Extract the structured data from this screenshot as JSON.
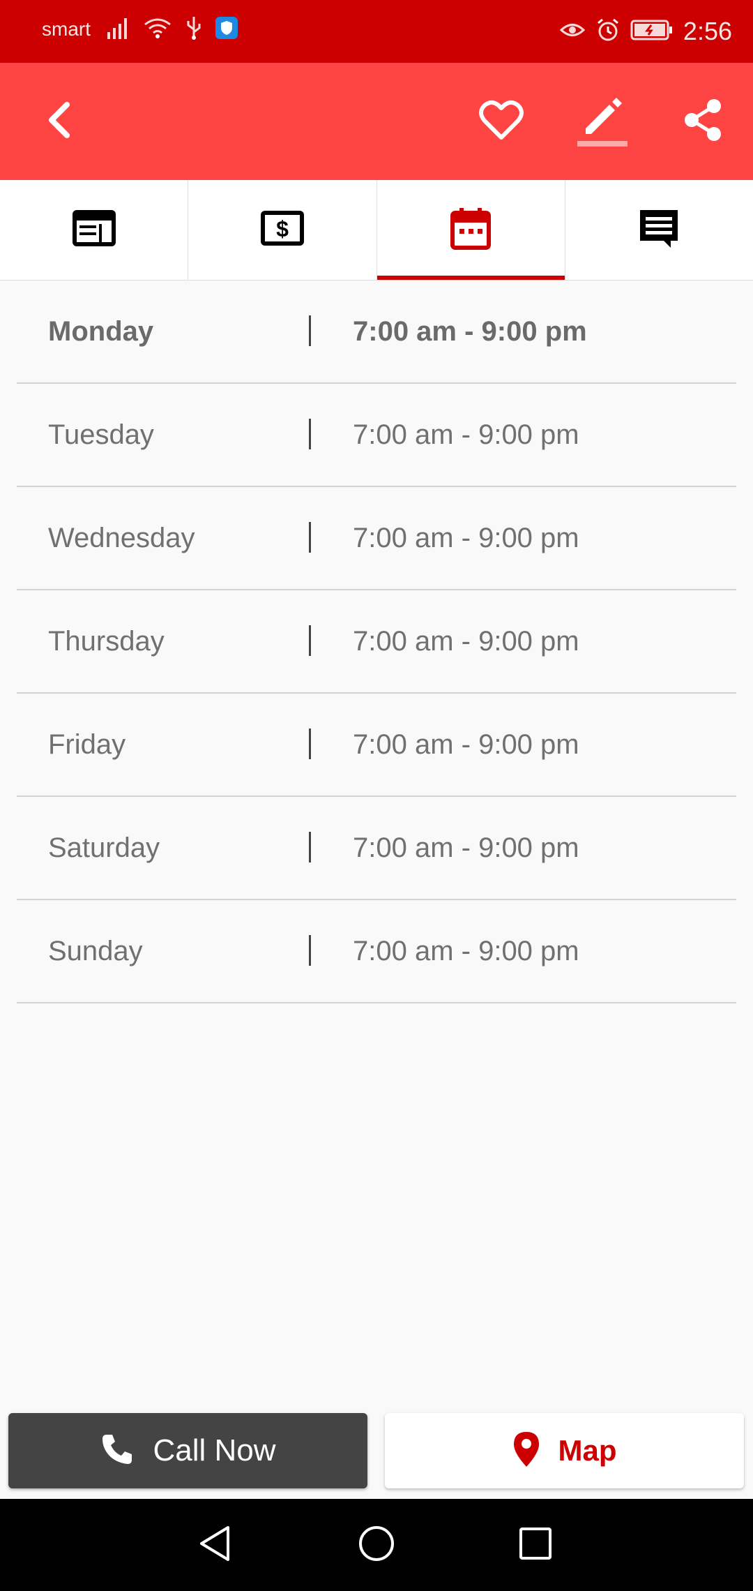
{
  "status_bar": {
    "carrier": "smart",
    "time": "2:56",
    "icons_left": [
      "signal-icon",
      "wifi-icon",
      "usb-icon",
      "shield-app-icon"
    ],
    "icons_right": [
      "eye-comfort-icon",
      "alarm-icon",
      "battery-icon"
    ]
  },
  "app_bar": {
    "actions": [
      "back-icon",
      "heart-icon",
      "edit-icon",
      "share-icon"
    ]
  },
  "tabs": {
    "items": [
      {
        "name": "overview-icon",
        "active": false
      },
      {
        "name": "price-icon",
        "active": false
      },
      {
        "name": "calendar-icon",
        "active": true
      },
      {
        "name": "comments-icon",
        "active": false
      }
    ],
    "active_color": "#cc0000"
  },
  "hours": [
    {
      "day": "Monday",
      "time": "7:00 am - 9:00 pm",
      "today": true
    },
    {
      "day": "Tuesday",
      "time": "7:00 am - 9:00 pm",
      "today": false
    },
    {
      "day": "Wednesday",
      "time": "7:00 am - 9:00 pm",
      "today": false
    },
    {
      "day": "Thursday",
      "time": "7:00 am - 9:00 pm",
      "today": false
    },
    {
      "day": "Friday",
      "time": "7:00 am - 9:00 pm",
      "today": false
    },
    {
      "day": "Saturday",
      "time": "7:00 am - 9:00 pm",
      "today": false
    },
    {
      "day": "Sunday",
      "time": "7:00 am - 9:00 pm",
      "today": false
    }
  ],
  "actions": {
    "call_label": "Call Now",
    "map_label": "Map"
  },
  "colors": {
    "status_bar": "#cc0000",
    "app_bar": "#ff4444",
    "accent": "#cc0000",
    "call_button": "#444444"
  }
}
